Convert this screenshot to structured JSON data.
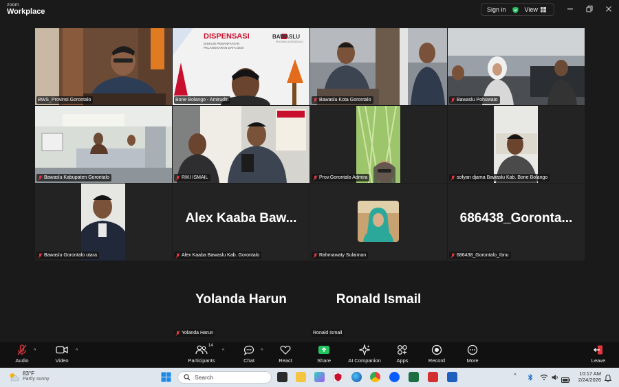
{
  "titlebar": {
    "brand_top": "zoom",
    "brand_bottom": "Workplace",
    "signin_label": "Sign in",
    "view_label": "View"
  },
  "tiles": [
    {
      "id": "bws",
      "label": "BWS_Provinsi Gorontalo",
      "active": true
    },
    {
      "id": "bone",
      "label": "Bone Bolango - Amirudin"
    },
    {
      "id": "kota",
      "label": "Bawaslu Kota Gorontalo"
    },
    {
      "id": "pohuwato",
      "label": "Bawaslu Pohuwato"
    },
    {
      "id": "kabupaten",
      "label": "Bawaslu Kabupaten Gorontalo"
    },
    {
      "id": "riki",
      "label": "RIKI ISMAIL"
    },
    {
      "id": "prov",
      "label": "Prov.Gorontalo Admira"
    },
    {
      "id": "sofyan",
      "label": "sofyan djama Bawaslu Kab. Bone Bolango"
    },
    {
      "id": "utara",
      "label": "Bawaslu Gorontalo utara"
    },
    {
      "id": "alex",
      "label": "Alex Kaaba Bawaslu Kab. Gorontalo",
      "big_name": "Alex Kaaba Baw..."
    },
    {
      "id": "rahmawaty",
      "label": "Rahmawaty Sulaiman"
    },
    {
      "id": "ibnu",
      "label": "686438_Gorontalo_Ibnu",
      "big_name": "686438_Goronta..."
    },
    {
      "id": "yolanda",
      "label": "Yolanda Harun",
      "big_name": "Yolanda Harun"
    },
    {
      "id": "ronald",
      "label": "Ronald Ismail",
      "big_name": "Ronald Ismail"
    }
  ],
  "slide": {
    "title": "DISPENSASI",
    "subtitle1": "DISKUSI PEMANFAATAN",
    "subtitle2": "PELANGGARAN DATA DESI",
    "logo": "BAWASLU",
    "logo_sub": "PROVINSI GORONTALO"
  },
  "toolbar": {
    "audio": "Audio",
    "video": "Video",
    "participants": "Participants",
    "participants_count": "14",
    "chat": "Chat",
    "react": "React",
    "share": "Share",
    "ai": "AI Companion",
    "apps": "Apps",
    "record": "Record",
    "more": "More",
    "leave": "Leave"
  },
  "taskbar": {
    "temp": "83°F",
    "weather": "Partly sunny",
    "search_placeholder": "Search",
    "time": "10:17 AM",
    "date": "2/24/2026"
  },
  "colors": {
    "active_border": "#2ecc71",
    "share_green": "#22c55e",
    "mic_muted_red": "#e0383e"
  }
}
